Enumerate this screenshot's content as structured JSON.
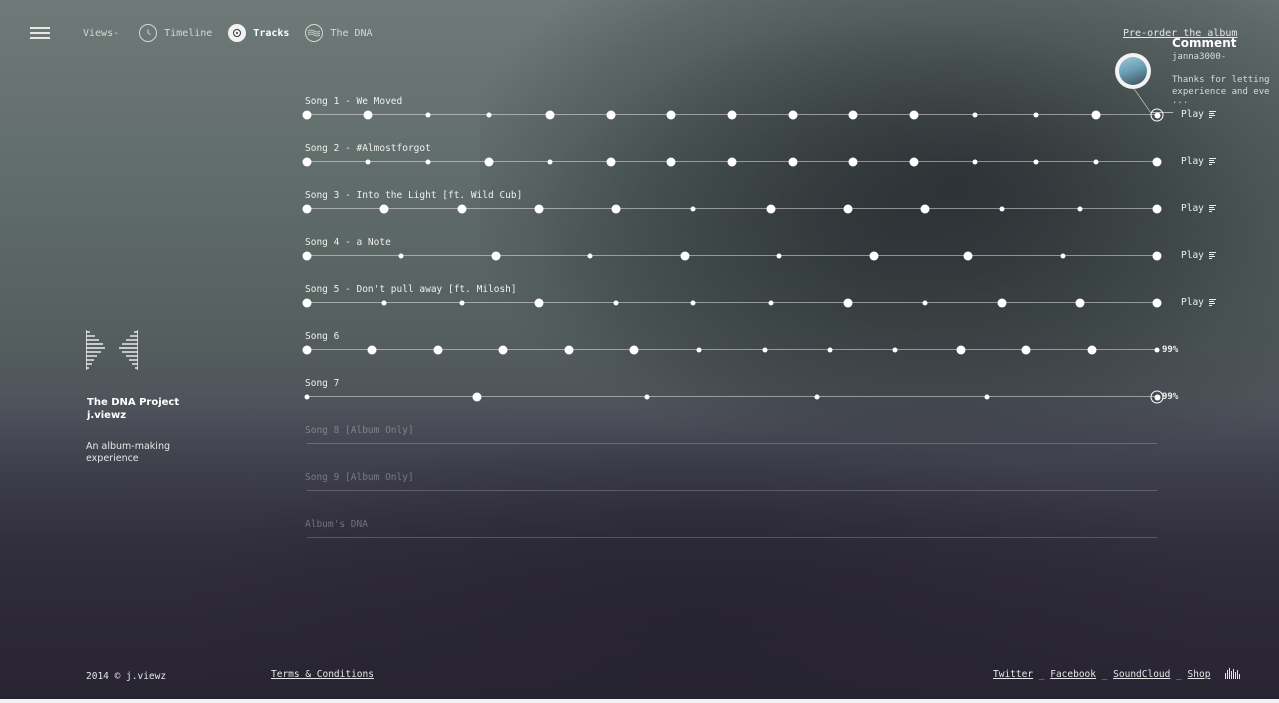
{
  "nav": {
    "views_label": "Views-",
    "items": [
      {
        "label": "Timeline",
        "icon": "clock-icon"
      },
      {
        "label": "Tracks",
        "icon": "vinyl-icon",
        "active": true
      },
      {
        "label": "The DNA",
        "icon": "dna-icon"
      }
    ]
  },
  "top_right": {
    "preorder_label": "Pre-order the album",
    "comment": {
      "title": "Comment",
      "user": "janna3000-",
      "text_line1": "Thanks for letting",
      "text_line2": "experience and eve",
      "text_line3": "..."
    }
  },
  "brand": {
    "title": "The DNA Project",
    "artist": "j.viewz",
    "sub_line1": "An album-making",
    "sub_line2": "experience"
  },
  "tracks": [
    {
      "label": "Song 1 - We Moved",
      "action": "Play",
      "dots": "BBSSBBBBBBBSSBR"
    },
    {
      "label": "Song 2 - #Almostforgot",
      "action": "Play",
      "dots": "BSSBSBBBBBBSSSB"
    },
    {
      "label": "Song 3 - Into the Light [ft. Wild Cub]",
      "action": "Play",
      "dots": "BBBBBSBBBSSB"
    },
    {
      "label": "Song 4 - a Note",
      "action": "Play",
      "dots": "BSBSBSBBSB"
    },
    {
      "label": "Song 5 - Don't pull away [ft. Milosh]",
      "action": "Play",
      "dots": "BSSBSSSBSBBB"
    },
    {
      "label": "Song 6",
      "progress": "99%",
      "dots": "BBBBBBSSSSBBBS"
    },
    {
      "label": "Song 7",
      "progress": "99%",
      "dots": "SBSSSR"
    },
    {
      "label": "Song 8 [Album Only]",
      "disabled": true
    },
    {
      "label": "Song 9 [Album Only]",
      "disabled": true
    },
    {
      "label": "Album's DNA",
      "disabled": true
    }
  ],
  "footer": {
    "copyright": "2014 © j.viewz",
    "terms_label": "Terms & Conditions",
    "social": [
      "Twitter",
      "Facebook",
      "SoundCloud",
      "Shop"
    ]
  },
  "colors": {
    "accent": "#ffffff",
    "text": "#e9ecea"
  }
}
